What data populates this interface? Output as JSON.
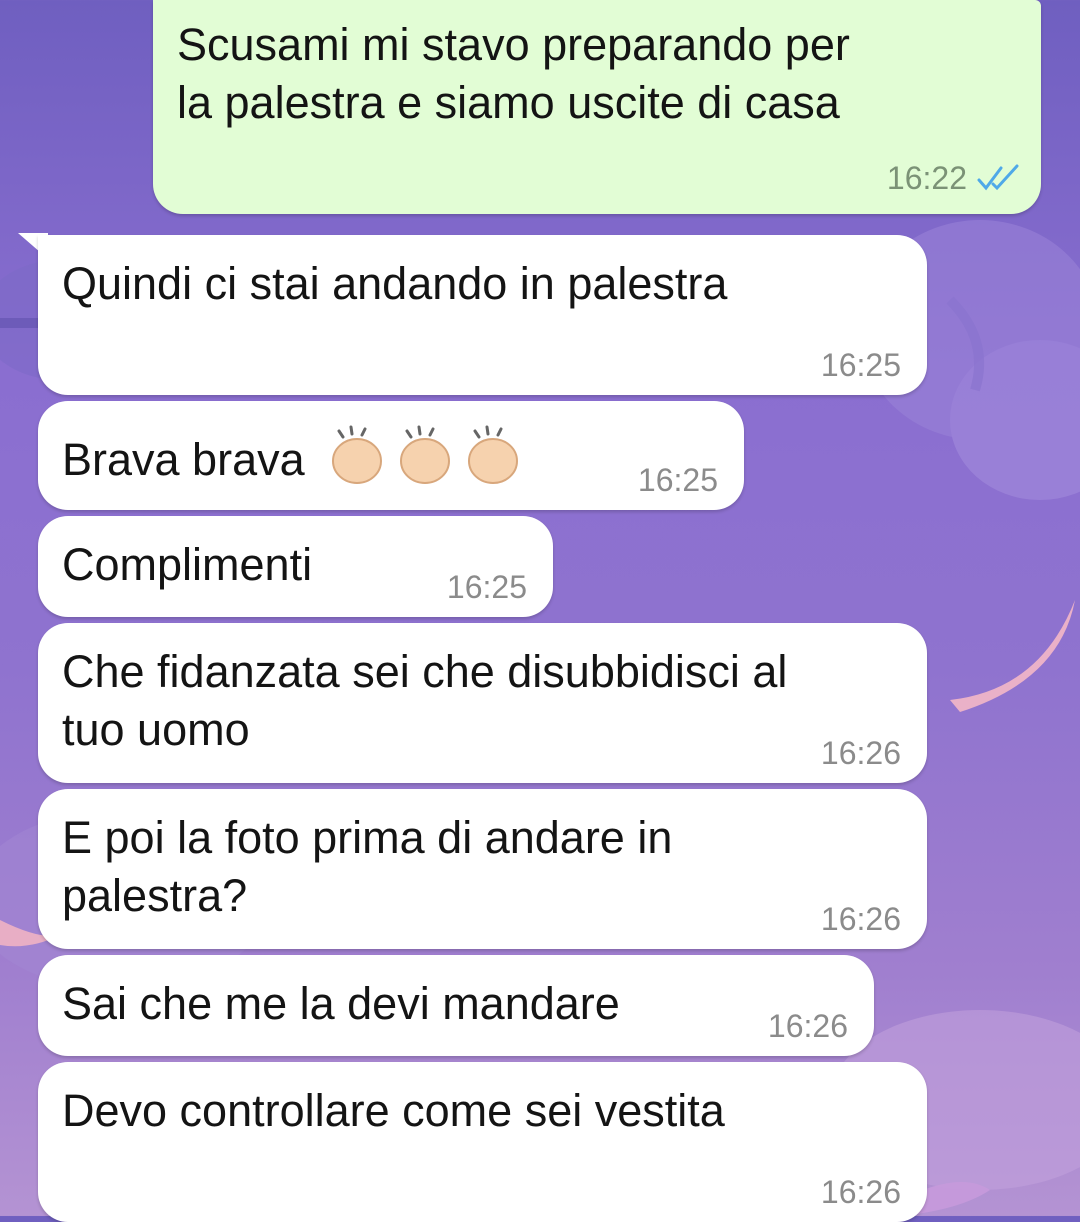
{
  "chat": {
    "messages": [
      {
        "direction": "outgoing",
        "text": "Scusami mi stavo preparando per\nla palestra e siamo uscite di casa",
        "time": "16:22",
        "status": "read"
      },
      {
        "direction": "incoming",
        "text": "Quindi ci stai andando in palestra",
        "time": "16:25"
      },
      {
        "direction": "incoming",
        "text": "Brava brava",
        "emoji": [
          "clapping-hands",
          "clapping-hands",
          "clapping-hands"
        ],
        "time": "16:25"
      },
      {
        "direction": "incoming",
        "text": "Complimenti",
        "time": "16:25"
      },
      {
        "direction": "incoming",
        "text": "Che fidanzata sei che disubbidisci al\ntuo uomo",
        "time": "16:26"
      },
      {
        "direction": "incoming",
        "text": "E poi la foto prima di andare in\npalestra?",
        "time": "16:26"
      },
      {
        "direction": "incoming",
        "text": "Sai che me la devi mandare",
        "time": "16:26"
      },
      {
        "direction": "incoming",
        "text": "Devo controllare come sei vestita",
        "time": "16:26"
      }
    ]
  },
  "colors": {
    "outgoing_bubble": "#e2fdd5",
    "incoming_bubble": "#ffffff",
    "read_ticks": "#4fa9e8",
    "background": "#8a6ed0"
  }
}
